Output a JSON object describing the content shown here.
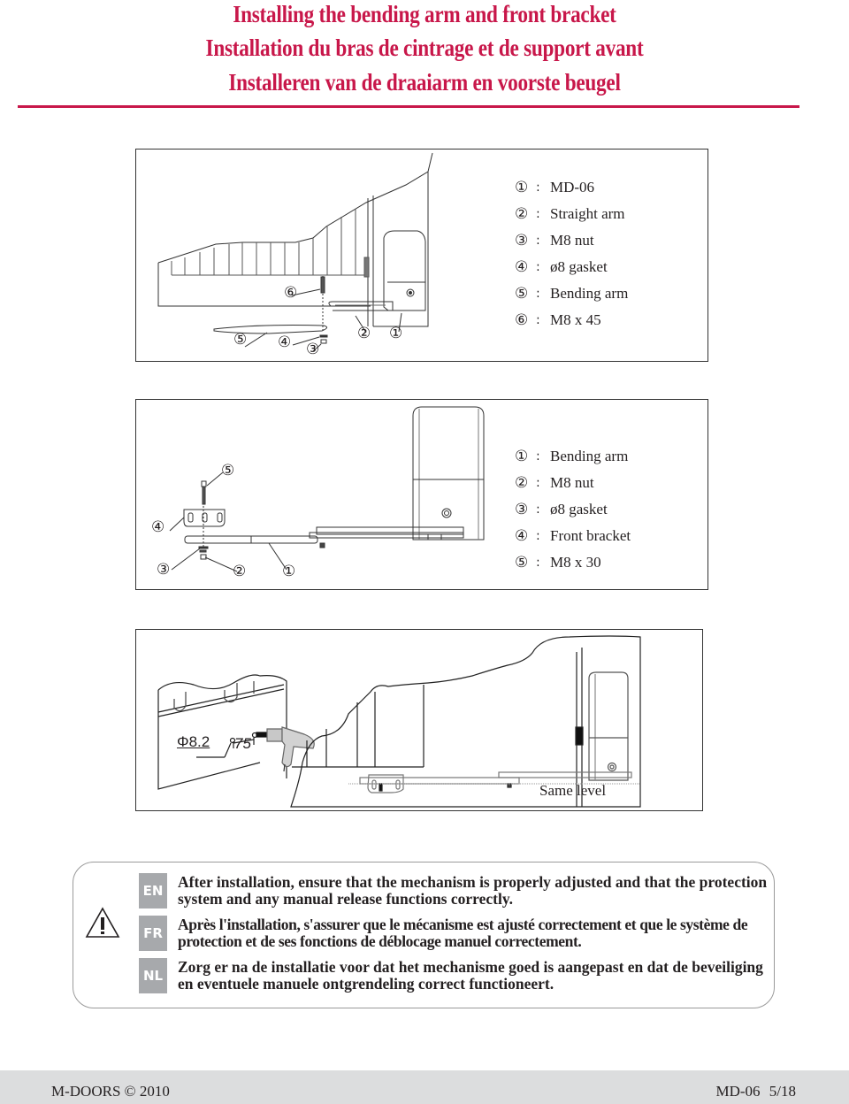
{
  "header": {
    "title_en": "Installing the bending arm and front bracket",
    "title_fr": "Installation du bras de cintrage et de support avant",
    "title_nl": "Installeren van de draaiarm en voorste beugel",
    "accent_color": "#c8174a"
  },
  "figure1": {
    "callouts": [
      "①",
      "②",
      "③",
      "④",
      "⑤",
      "⑥"
    ],
    "legend": [
      {
        "num": "①",
        "label": "MD-06"
      },
      {
        "num": "②",
        "label": "Straight arm"
      },
      {
        "num": "③",
        "label": "M8 nut"
      },
      {
        "num": "④",
        "label": "ø8 gasket"
      },
      {
        "num": "⑤",
        "label": "Bending arm"
      },
      {
        "num": "⑥",
        "label": "M8 x 45"
      }
    ]
  },
  "figure2": {
    "callouts": [
      "①",
      "②",
      "③",
      "④",
      "⑤"
    ],
    "legend": [
      {
        "num": "①",
        "label": "Bending arm"
      },
      {
        "num": "②",
        "label": "M8 nut"
      },
      {
        "num": "③",
        "label": "ø8 gasket"
      },
      {
        "num": "④",
        "label": "Front bracket"
      },
      {
        "num": "⑤",
        "label": "M8 x 30"
      }
    ]
  },
  "figure3": {
    "hole_diameter": "Φ8.2",
    "distance": "75",
    "same_level_label": "Same level"
  },
  "warning": {
    "icon": "warning-triangle-icon",
    "languages": [
      {
        "code": "EN",
        "text": "After installation, ensure that the mechanism is properly adjusted and that the protection system and any manual release functions correctly."
      },
      {
        "code": "FR",
        "text": "Après l'installation, s'assurer que le mécanisme est ajusté correctement et que le système de protection et de ses fonctions de déblocage manuel correctement."
      },
      {
        "code": "NL",
        "text": "Zorg er na de installatie voor dat het mechanisme goed is aangepast en dat de beveiliging en eventuele manuele ontgrendeling correct functioneert."
      }
    ]
  },
  "footer": {
    "brand": "M-DOORS © 2010",
    "model": "MD-06",
    "page": "5/18"
  }
}
